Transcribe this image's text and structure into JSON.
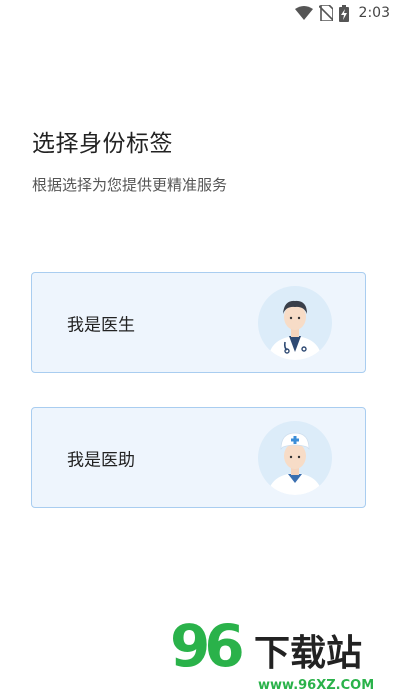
{
  "status_bar": {
    "time": "2:03",
    "icons": [
      "wifi-icon",
      "no-sim-icon",
      "battery-charging-icon"
    ]
  },
  "page": {
    "title": "选择身份标签",
    "subtitle": "根据选择为您提供更精准服务"
  },
  "roles": [
    {
      "label": "我是医生",
      "avatar": "doctor-avatar-icon"
    },
    {
      "label": "我是医助",
      "avatar": "nurse-avatar-icon"
    }
  ],
  "colors": {
    "card_bg": "#eef5fd",
    "card_border": "#a9cdf0",
    "avatar_bg": "#dcecf9",
    "watermark_green": "#2ab24a"
  },
  "watermark": {
    "number": "96",
    "text": "下载站",
    "url": "www.96XZ.COM"
  }
}
